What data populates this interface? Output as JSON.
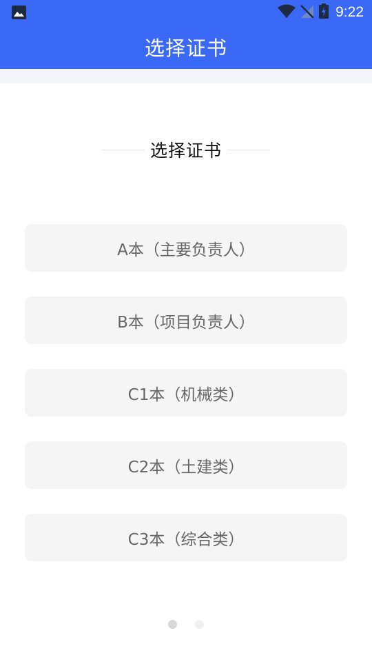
{
  "status_bar": {
    "time": "9:22",
    "icons": [
      "image-icon",
      "wifi-icon",
      "no-signal-icon",
      "battery-charging-icon"
    ],
    "color": "#3969f5"
  },
  "app_bar": {
    "title": "选择证书"
  },
  "section": {
    "title": "选择证书"
  },
  "options": [
    {
      "label": "A本（主要负责人）"
    },
    {
      "label": "B本（项目负责人）"
    },
    {
      "label": "C1本（机械类）"
    },
    {
      "label": "C2本（土建类）"
    },
    {
      "label": "C3本（综合类）"
    }
  ],
  "pager": {
    "count": 2,
    "active_index": 0
  },
  "colors": {
    "accent": "#3969f5",
    "option_bg": "#f5f5f5",
    "option_text": "#666666"
  }
}
